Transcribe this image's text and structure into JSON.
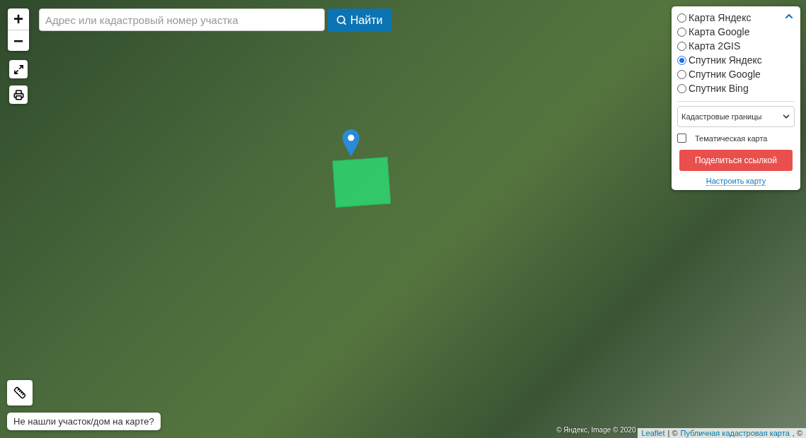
{
  "zoom_controls": [
    "+",
    "−"
  ],
  "search": {
    "placeholder": "Адрес или кадастровый номер участка",
    "button": "Найти"
  },
  "layers": [
    {
      "label": "Карта Яндекс",
      "selected": false
    },
    {
      "label": "Карта Google",
      "selected": false
    },
    {
      "label": "Карта 2GIS",
      "selected": false
    },
    {
      "label": "Спутник Яндекс",
      "selected": true
    },
    {
      "label": "Спутник Google",
      "selected": false
    },
    {
      "label": "Спутник Bing",
      "selected": false
    }
  ],
  "overlay_select": {
    "value": "Кадастровые границы"
  },
  "thematic": {
    "label": "Тематическая карта",
    "checked": false
  },
  "share_button": "Поделиться ссылкой",
  "settings_link": "Настроить карту",
  "help_button": "Не нашли участок/дом на карте?",
  "map_attribution": "© Яндекс, Image © 2020",
  "attribution": [
    {
      "kind": "link",
      "text": "Leaflet"
    },
    {
      "kind": "text",
      "text": "| ©"
    },
    {
      "kind": "link",
      "text": "Публичная кадастровая карта"
    },
    {
      "kind": "text",
      "text": ", ©"
    }
  ]
}
